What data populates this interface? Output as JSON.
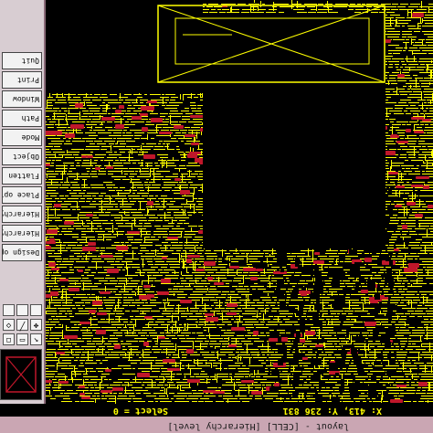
{
  "window": {
    "title": "layout - [CELL] [Hierarchy level]"
  },
  "status": {
    "coordinates": "X: 413,  Y: 236 831",
    "select": "Select = 0"
  },
  "menu": {
    "items": [
      {
        "label": "Design options"
      },
      {
        "label": "Hierarchy"
      },
      {
        "label": "Hierarchy"
      },
      {
        "label": "Place option"
      },
      {
        "label": "Flatten"
      },
      {
        "label": "Object"
      },
      {
        "label": "Mode"
      },
      {
        "label": "Path"
      },
      {
        "label": "Window"
      },
      {
        "label": "Print"
      },
      {
        "label": "Quit"
      }
    ]
  },
  "toolbar": {
    "tools": [
      {
        "icon": "arrow-icon",
        "glyph": "↖"
      },
      {
        "icon": "box-icon",
        "glyph": "▭"
      },
      {
        "icon": "zoom-icon",
        "glyph": "◻"
      },
      {
        "icon": "move-icon",
        "glyph": "✥"
      },
      {
        "icon": "path-icon",
        "glyph": "╱"
      },
      {
        "icon": "poly-icon",
        "glyph": "◇"
      }
    ]
  },
  "colors": {
    "metal": "#ffff00",
    "poly": "#c0172a",
    "background": "#000000",
    "frame": "#c6a0ae"
  }
}
